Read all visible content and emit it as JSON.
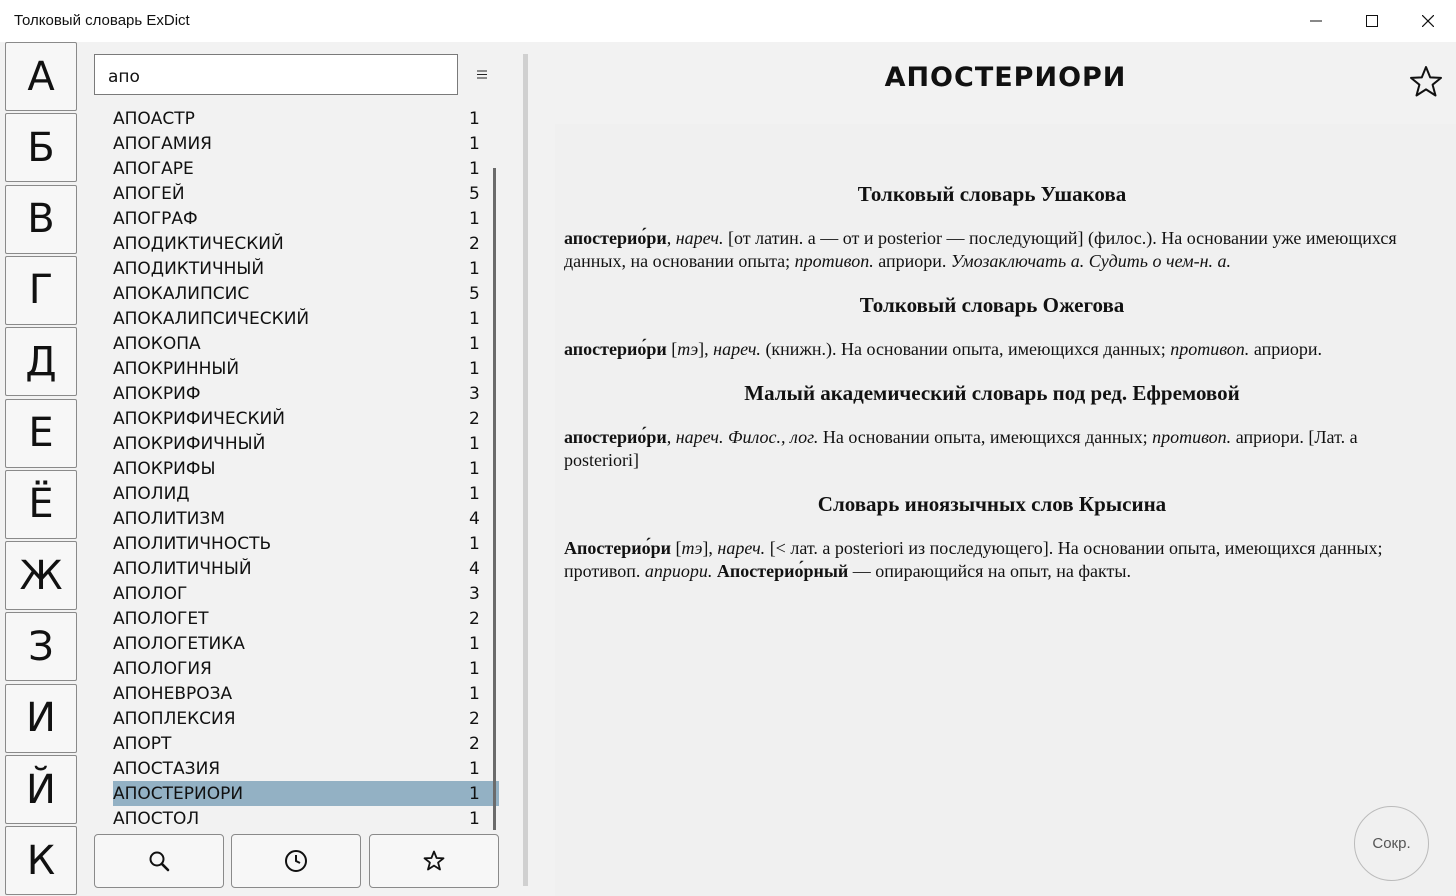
{
  "window": {
    "title": "Толковый словарь ExDict",
    "minimize_icon": "minimize-icon",
    "maximize_icon": "maximize-icon",
    "close_icon": "close-icon"
  },
  "alphabet": [
    "А",
    "Б",
    "В",
    "Г",
    "Д",
    "Е",
    "Ё",
    "Ж",
    "З",
    "И",
    "Й",
    "К"
  ],
  "search": {
    "value": "апо",
    "menu_icon": "hamburger-icon"
  },
  "words": [
    {
      "word": "АПОАСТР",
      "count": "1"
    },
    {
      "word": "АПОГАМИЯ",
      "count": "1"
    },
    {
      "word": "АПОГАРЕ",
      "count": "1"
    },
    {
      "word": "АПОГЕЙ",
      "count": "5"
    },
    {
      "word": "АПОГРАФ",
      "count": "1"
    },
    {
      "word": "АПОДИКТИЧЕСКИЙ",
      "count": "2"
    },
    {
      "word": "АПОДИКТИЧНЫЙ",
      "count": "1"
    },
    {
      "word": "АПОКАЛИПСИС",
      "count": "5"
    },
    {
      "word": "АПОКАЛИПСИЧЕСКИЙ",
      "count": "1"
    },
    {
      "word": "АПОКОПА",
      "count": "1"
    },
    {
      "word": "АПОКРИННЫЙ",
      "count": "1"
    },
    {
      "word": "АПОКРИФ",
      "count": "3"
    },
    {
      "word": "АПОКРИФИЧЕСКИЙ",
      "count": "2"
    },
    {
      "word": "АПОКРИФИЧНЫЙ",
      "count": "1"
    },
    {
      "word": "АПОКРИФЫ",
      "count": "1"
    },
    {
      "word": "АПОЛИД",
      "count": "1"
    },
    {
      "word": "АПОЛИТИЗМ",
      "count": "4"
    },
    {
      "word": "АПОЛИТИЧНОСТЬ",
      "count": "1"
    },
    {
      "word": "АПОЛИТИЧНЫЙ",
      "count": "4"
    },
    {
      "word": "АПОЛОГ",
      "count": "3"
    },
    {
      "word": "АПОЛОГЕТ",
      "count": "2"
    },
    {
      "word": "АПОЛОГЕТИКА",
      "count": "1"
    },
    {
      "word": "АПОЛОГИЯ",
      "count": "1"
    },
    {
      "word": "АПОНЕВРОЗА",
      "count": "1"
    },
    {
      "word": "АПОПЛЕКСИЯ",
      "count": "2"
    },
    {
      "word": "АПОРТ",
      "count": "2"
    },
    {
      "word": "АПОСТАЗИЯ",
      "count": "1"
    },
    {
      "word": "АПОСТЕРИОРИ",
      "count": "1"
    },
    {
      "word": "АПОСТОЛ",
      "count": "1"
    }
  ],
  "selected_word_index": 27,
  "bottom_buttons": {
    "search_icon": "search-icon",
    "history_icon": "clock-icon",
    "favorites_icon": "star-icon"
  },
  "article": {
    "title": "АПОСТЕРИОРИ",
    "favorite_icon": "star-outline-icon",
    "sections": [
      {
        "heading": "Толковый словарь Ушакова",
        "parts": [
          {
            "t": "апостерио́ри",
            "s": "b"
          },
          {
            "t": ", ",
            "s": ""
          },
          {
            "t": "нареч.",
            "s": "i"
          },
          {
            "t": " [от латин. a — от и posterior — последующий] (филос.). На основании уже имеющихся данных, на основании опыта; ",
            "s": ""
          },
          {
            "t": "противоп.",
            "s": "i"
          },
          {
            "t": " априори. ",
            "s": ""
          },
          {
            "t": "Умозаключать а. Судить о чем-н. а.",
            "s": "i"
          }
        ]
      },
      {
        "heading": "Толковый словарь Ожегова",
        "parts": [
          {
            "t": "апостерио́ри",
            "s": "b"
          },
          {
            "t": " [",
            "s": ""
          },
          {
            "t": "тэ",
            "s": "i"
          },
          {
            "t": "], ",
            "s": ""
          },
          {
            "t": "нареч.",
            "s": "i"
          },
          {
            "t": " (книжн.). На основании опыта, имеющихся данных; ",
            "s": ""
          },
          {
            "t": "противоп.",
            "s": "i"
          },
          {
            "t": " априори.",
            "s": ""
          }
        ]
      },
      {
        "heading": "Малый академический словарь под ред. Ефремовой",
        "parts": [
          {
            "t": "апостерио́ри",
            "s": "b"
          },
          {
            "t": ", ",
            "s": ""
          },
          {
            "t": "нареч. Филос., лог.",
            "s": "i"
          },
          {
            "t": " На основании опыта, имеющихся данных; ",
            "s": ""
          },
          {
            "t": "противоп.",
            "s": "i"
          },
          {
            "t": " априори. [Лат. a posteriori]",
            "s": ""
          }
        ]
      },
      {
        "heading": "Словарь иноязычных слов Крысина",
        "parts": [
          {
            "t": "Апостерио́ри",
            "s": "b"
          },
          {
            "t": " [",
            "s": ""
          },
          {
            "t": "тэ",
            "s": "i"
          },
          {
            "t": "], ",
            "s": ""
          },
          {
            "t": "нареч.",
            "s": "i"
          },
          {
            "t": " [< лат. a posteriori из последующего]. На основании опыта, имеющихся данных; противоп. ",
            "s": ""
          },
          {
            "t": "априори.",
            "s": "i"
          },
          {
            "t": " ",
            "s": ""
          },
          {
            "t": "Апостерио́рный",
            "s": "b"
          },
          {
            "t": " — опирающийся на опыт, на факты.",
            "s": ""
          }
        ]
      }
    ]
  },
  "abbreviations_button": "Сокр.",
  "colors": {
    "selection": "#93b1c4",
    "background": "#f2f2f2"
  }
}
